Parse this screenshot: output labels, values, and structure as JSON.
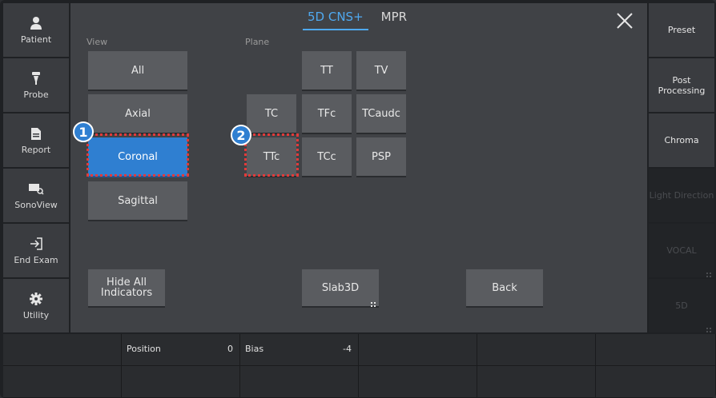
{
  "left_sidebar": {
    "items": [
      {
        "label": "Patient",
        "icon": "person-icon"
      },
      {
        "label": "Probe",
        "icon": "probe-icon"
      },
      {
        "label": "Report",
        "icon": "document-icon"
      },
      {
        "label": "SonoView",
        "icon": "sonoview-icon"
      },
      {
        "label": "End Exam",
        "icon": "exit-icon"
      },
      {
        "label": "Utility",
        "icon": "gear-icon"
      }
    ]
  },
  "tabs": [
    {
      "label": "5D CNS+",
      "active": true
    },
    {
      "label": "MPR",
      "active": false
    }
  ],
  "view": {
    "label": "View",
    "buttons": [
      "All",
      "Axial",
      "Coronal",
      "Sagittal"
    ],
    "selected": "Coronal"
  },
  "plane": {
    "label": "Plane",
    "buttons": [
      "TT",
      "TV",
      "TC",
      "TFc",
      "TCaudc",
      "TTc",
      "TCc",
      "PSP"
    ]
  },
  "actions": {
    "hide_all_indicators": "Hide All Indicators",
    "slab3d": "Slab3D",
    "back": "Back"
  },
  "annotations": {
    "one": "1",
    "two": "2"
  },
  "right_sidebar": {
    "items": [
      {
        "label": "Preset",
        "enabled": true
      },
      {
        "label": "Post Processing",
        "enabled": true
      },
      {
        "label": "Chroma",
        "enabled": true
      },
      {
        "label": "Light Direction",
        "enabled": false
      },
      {
        "label": "VOCAL",
        "enabled": false
      },
      {
        "label": "5D",
        "enabled": false
      }
    ]
  },
  "bottom_params": {
    "position": {
      "label": "Position",
      "value": "0"
    },
    "bias": {
      "label": "Bias",
      "value": "-4"
    }
  },
  "colors": {
    "accent": "#2f7fd1",
    "tab_active": "#4fa9f0",
    "highlight_dash": "#e23a3a"
  }
}
